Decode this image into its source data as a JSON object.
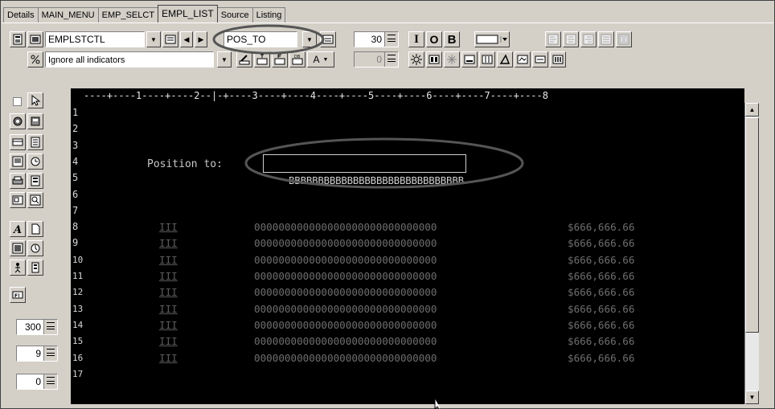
{
  "tabs": [
    {
      "label": "Details",
      "active": false
    },
    {
      "label": "MAIN_MENU",
      "active": false
    },
    {
      "label": "EMP_SELCT",
      "active": false
    },
    {
      "label": "EMPL_LIST",
      "active": true
    },
    {
      "label": "Source",
      "active": false
    },
    {
      "label": "Listing",
      "active": false
    }
  ],
  "toolbar": {
    "record_format_combo": "EMPLSTCTL",
    "field_combo": "POS_TO",
    "length_value": "30",
    "indicators_combo": "Ignore all indicators",
    "indicator_value": "0",
    "style_buttons": [
      "I",
      "O",
      "B"
    ],
    "color_button_label": "A"
  },
  "side_palette": {
    "spin_values": [
      "300",
      "9",
      "0"
    ]
  },
  "ruler": {
    "text": "----+----1----+----2--|-+----3----+----4----+----5----+----6----+----7----+----8"
  },
  "screen": {
    "line_numbers": [
      "1",
      "2",
      "3",
      "4",
      "5",
      "6",
      "7",
      "8",
      "9",
      "10",
      "11",
      "12",
      "13",
      "14",
      "15",
      "16",
      "17"
    ],
    "position_label": "Position to:",
    "position_field": "BBBBBBBBBBBBBBBBBBBBBBBBBBBBBB",
    "rows": [
      {
        "sel": "III",
        "name": "000000000000000000000000000000",
        "amount": "$666,666.66"
      },
      {
        "sel": "III",
        "name": "000000000000000000000000000000",
        "amount": "$666,666.66"
      },
      {
        "sel": "III",
        "name": "000000000000000000000000000000",
        "amount": "$666,666.66"
      },
      {
        "sel": "III",
        "name": "000000000000000000000000000000",
        "amount": "$666,666.66"
      },
      {
        "sel": "III",
        "name": "000000000000000000000000000000",
        "amount": "$666,666.66"
      },
      {
        "sel": "III",
        "name": "000000000000000000000000000000",
        "amount": "$666,666.66"
      },
      {
        "sel": "III",
        "name": "000000000000000000000000000000",
        "amount": "$666,666.66"
      },
      {
        "sel": "III",
        "name": "000000000000000000000000000000",
        "amount": "$666,666.66"
      },
      {
        "sel": "III",
        "name": "000000000000000000000000000000",
        "amount": "$666,666.66"
      }
    ]
  },
  "colors": {
    "screen_bg": "#000000",
    "text": "#d8d8d8",
    "dim_text": "#7a7a7a",
    "highlight_ellipse": "#555555"
  }
}
